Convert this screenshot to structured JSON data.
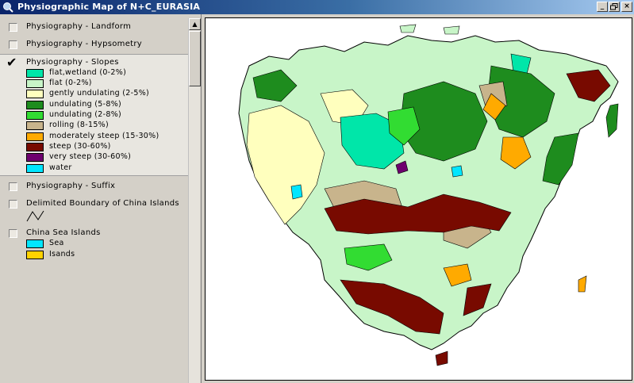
{
  "window": {
    "title": "Physiographic Map of N+C_EURASIA",
    "app_icon": "arcview-globe-icon",
    "controls": [
      "_",
      "×"
    ]
  },
  "toc": {
    "layers": [
      {
        "name": "Physiography - Landform",
        "checked": false
      },
      {
        "name": "Physiography - Hypsometry",
        "checked": false
      },
      {
        "name": "Physiography - Slopes",
        "checked": true,
        "legend": [
          {
            "label": "flat,wetland (0-2%)",
            "color": "#00e6a9"
          },
          {
            "label": "flat (0-2%)",
            "color": "#c8f5c8"
          },
          {
            "label": "gently undulating (2-5%)",
            "color": "#ffffbe"
          },
          {
            "label": "undulating (5-8%)",
            "color": "#1e8c1e"
          },
          {
            "label": "undulating (2-8%)",
            "color": "#32dc32"
          },
          {
            "label": "rolling (8-15%)",
            "color": "#c8b48c"
          },
          {
            "label": "moderately steep (15-30%)",
            "color": "#ffaa00"
          },
          {
            "label": "steep (30-60%)",
            "color": "#780a00"
          },
          {
            "label": "very steep (30-60%)",
            "color": "#6e006e"
          },
          {
            "label": "water",
            "color": "#00e6ff"
          }
        ]
      },
      {
        "name": "Physiography - Suffix",
        "checked": false
      },
      {
        "name": "Delimited Boundary of China Islands",
        "checked": false
      },
      {
        "name": "China Sea Islands",
        "checked": false,
        "legend": [
          {
            "label": "Sea",
            "color": "#00e6ff"
          },
          {
            "label": "Isands",
            "color": "#ffd200"
          }
        ]
      }
    ]
  }
}
